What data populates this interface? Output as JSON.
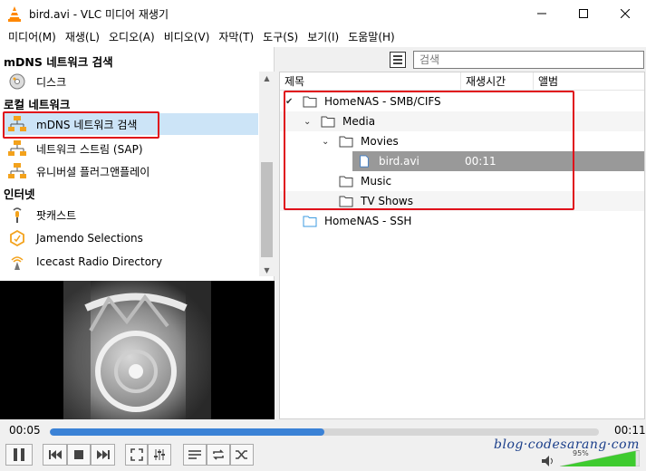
{
  "window": {
    "title": "bird.avi - VLC 미디어 재생기"
  },
  "menu": [
    "미디어(M)",
    "재생(L)",
    "오디오(A)",
    "비디오(V)",
    "자막(T)",
    "도구(S)",
    "보기(I)",
    "도움말(H)"
  ],
  "sidebar": {
    "header": "mDNS 네트워크 검색",
    "sections": [
      {
        "title": ""
      },
      {
        "title": "로컬 네트워크"
      },
      {
        "title": "인터넷"
      }
    ],
    "items": [
      {
        "label": "디스크",
        "icon": "disc-icon"
      },
      {
        "label": "mDNS 네트워크 검색",
        "icon": "network-icon",
        "selected": true
      },
      {
        "label": "네트워크 스트림 (SAP)",
        "icon": "network-icon"
      },
      {
        "label": "유니버셜 플러그앤플레이",
        "icon": "network-icon"
      },
      {
        "label": "팟캐스트",
        "icon": "podcast-icon"
      },
      {
        "label": "Jamendo Selections",
        "icon": "jamendo-icon"
      },
      {
        "label": "Icecast Radio Directory",
        "icon": "icecast-icon"
      }
    ]
  },
  "search": {
    "placeholder": "검색"
  },
  "playlist": {
    "columns": [
      "제목",
      "재생시간",
      "앨범"
    ],
    "rows": [
      {
        "name": "HomeNAS - SMB/CIFS",
        "type": "folder",
        "expanded": true,
        "depth": 0
      },
      {
        "name": "Media",
        "type": "folder",
        "expanded": true,
        "depth": 1
      },
      {
        "name": "Movies",
        "type": "folder",
        "expanded": true,
        "depth": 2
      },
      {
        "name": "bird.avi",
        "type": "file",
        "duration": "00:11",
        "depth": 3,
        "selected": true
      },
      {
        "name": "Music",
        "type": "folder",
        "depth": 2
      },
      {
        "name": "TV Shows",
        "type": "folder",
        "depth": 2
      },
      {
        "name": "HomeNAS - SSH",
        "type": "folder",
        "depth": 0,
        "color": "#3c9be0"
      }
    ]
  },
  "player": {
    "elapsed": "00:05",
    "total": "00:11",
    "progress": 0.5,
    "volume": "95%",
    "volume_level": 0.95,
    "watermark": "blog·codesarang·com"
  },
  "colors": {
    "accent": "#3b82d6",
    "highlight": "#e0101a",
    "selection": "#cce4f7"
  }
}
